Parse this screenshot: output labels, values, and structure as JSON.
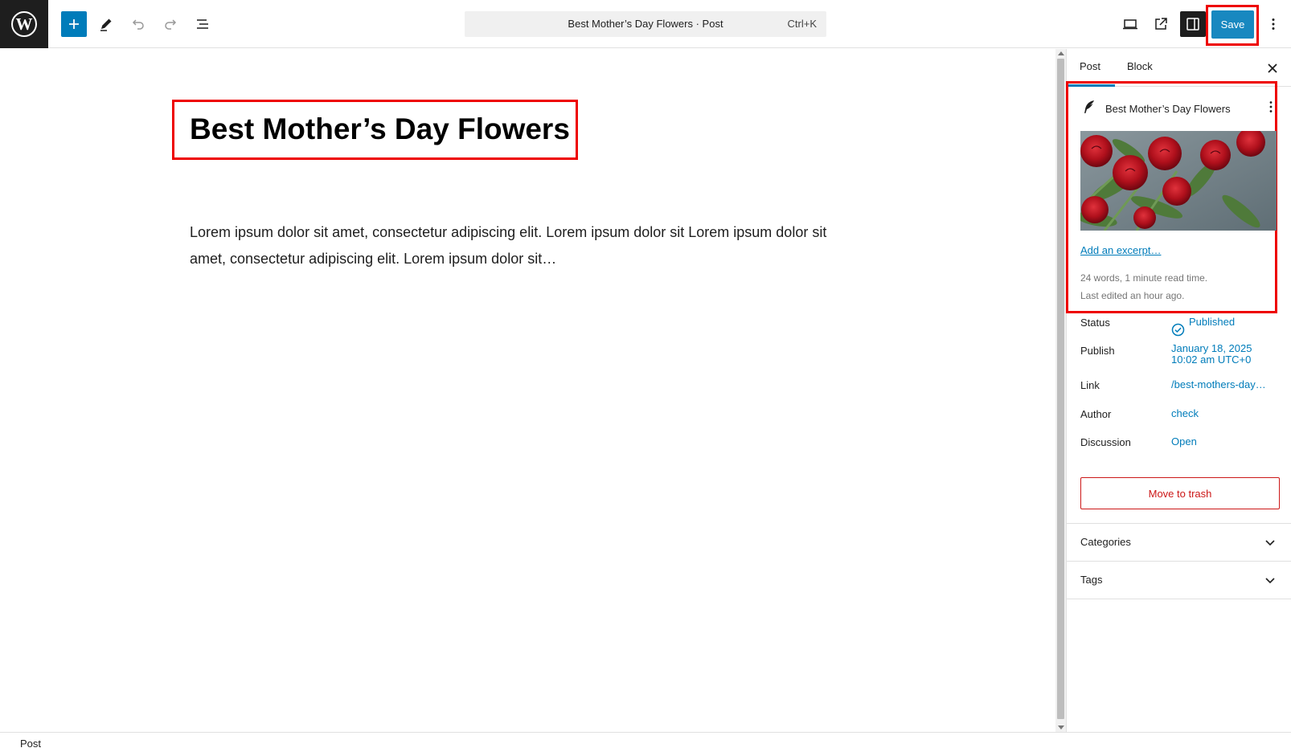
{
  "toolbar": {
    "document_title": "Best Mother’s Day Flowers · Post",
    "shortcut": "Ctrl+K",
    "save_label": "Save"
  },
  "editor": {
    "title": "Best Mother’s Day Flowers",
    "body": "Lorem ipsum dolor sit amet, consectetur adipiscing elit. Lorem ipsum dolor sit Lorem ipsum dolor sit amet, consectetur adipiscing elit. Lorem ipsum dolor sit…"
  },
  "sidebar": {
    "tabs": [
      "Post",
      "Block"
    ],
    "summary": {
      "title": "Best Mother’s Day Flowers",
      "excerpt_link": "Add an excerpt…",
      "word_count": "24 words, 1 minute read time.",
      "last_edited": "Last edited an hour ago."
    },
    "rows": {
      "status_label": "Status",
      "status_value": "Published",
      "publish_label": "Publish",
      "publish_date": "January 18, 2025",
      "publish_time": "10:02 am UTC+0",
      "link_label": "Link",
      "link_value": "/best-mothers-day…",
      "author_label": "Author",
      "author_value": "check",
      "discussion_label": "Discussion",
      "discussion_value": "Open"
    },
    "trash_label": "Move to trash",
    "panels": [
      "Categories",
      "Tags"
    ]
  },
  "footer": {
    "breadcrumb": "Post"
  },
  "colors": {
    "accent": "#007cba",
    "highlight": "#ee0000",
    "danger": "#cc1818"
  }
}
